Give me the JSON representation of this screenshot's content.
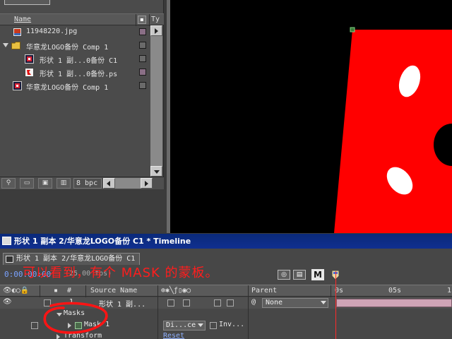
{
  "project": {
    "header": {
      "name_label": "Name",
      "type_label": "Ty",
      "label_icon": "label-icon"
    },
    "items": [
      {
        "name": "11948220.jpg",
        "type": "image",
        "label_color": "#8a6f86"
      },
      {
        "name": "华意龙LOGO备份 Comp 1",
        "type": "folder",
        "label_color": "#6a6a6a"
      },
      {
        "name": "形状 1 副...0备份 C1",
        "type": "comp",
        "label_color": "#6a6a6a"
      },
      {
        "name": "形状 1 副...0备份.ps",
        "type": "psd",
        "label_color": "#8a6f86"
      },
      {
        "name": "华意龙LOGO备份 Comp 1",
        "type": "comp",
        "label_color": "#6a6a6a"
      }
    ],
    "footer": {
      "bpc": "8 bpc"
    }
  },
  "timeline": {
    "window_title": "形状 1 副本 2/华意龙LOGO备份 C1 * Timeline",
    "tab_label": "形状 1 副本 2/华意龙LOGO备份 C1",
    "timecode": "0:00:00:00",
    "fps": "(25.00 fps)",
    "annotation": "可以看到，有个 MASK 的蒙板。",
    "columns": {
      "number": "#",
      "source_name": "Source Name",
      "parent": "Parent",
      "t0": "0s",
      "t5": "05s",
      "t10": "1"
    },
    "layer": {
      "number": "1",
      "name": "形状 1 副...",
      "parent": "None"
    },
    "masks_label": "Masks",
    "mask1_label": "Mask 1",
    "mask_mode": "Di...ce",
    "inverted_label": "Inv...",
    "transform_label": "Transform",
    "reset_label": "Reset",
    "m_button": "M"
  },
  "colors": {
    "accent_red": "#ff0000",
    "title_blue": "#0a2a7a"
  }
}
